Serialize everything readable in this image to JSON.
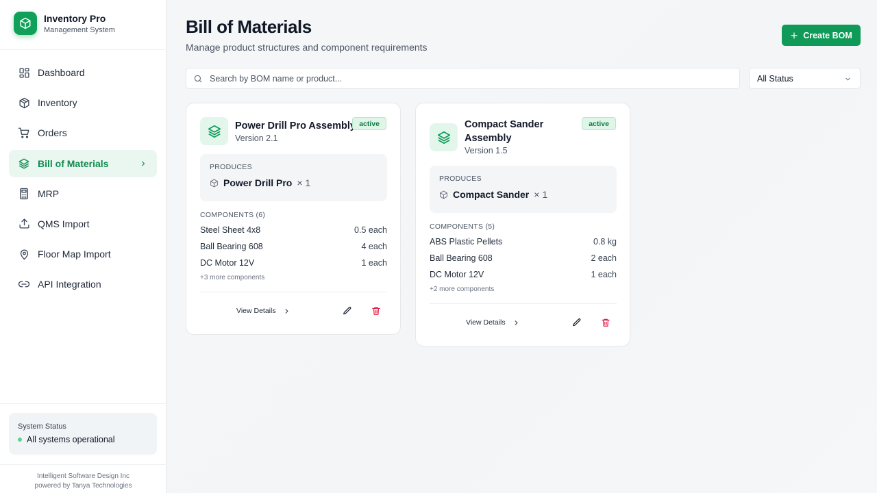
{
  "brand": {
    "title": "Inventory Pro",
    "subtitle": "Management System"
  },
  "nav": [
    {
      "label": "Dashboard",
      "icon": "dashboard-icon"
    },
    {
      "label": "Inventory",
      "icon": "box-icon"
    },
    {
      "label": "Orders",
      "icon": "cart-icon"
    },
    {
      "label": "Bill of Materials",
      "icon": "layers-icon",
      "active": true
    },
    {
      "label": "MRP",
      "icon": "calculator-icon"
    },
    {
      "label": "QMS Import",
      "icon": "upload-icon"
    },
    {
      "label": "Floor Map Import",
      "icon": "map-pin-icon"
    },
    {
      "label": "API Integration",
      "icon": "link-icon"
    }
  ],
  "system_status": {
    "label": "System Status",
    "text": "All systems operational"
  },
  "footer": {
    "line1": "Intelligent Software Design Inc",
    "line2": "powered by Tanya Technologies"
  },
  "header": {
    "title": "Bill of Materials",
    "subtitle": "Manage product structures and component requirements",
    "create_label": "Create BOM"
  },
  "search": {
    "placeholder": "Search by BOM name or product..."
  },
  "status_filter": {
    "selected": "All Status"
  },
  "cards": [
    {
      "title": "Power Drill Pro Assembly",
      "version": "Version 2.1",
      "status": "active",
      "produces_label": "PRODUCES",
      "product": "Power Drill Pro",
      "product_qty": "× 1",
      "components_label": "COMPONENTS (6)",
      "components": [
        {
          "name": "Steel Sheet 4x8",
          "qty": "0.5 each"
        },
        {
          "name": "Ball Bearing 608",
          "qty": "4 each"
        },
        {
          "name": "DC Motor 12V",
          "qty": "1 each"
        }
      ],
      "more": "+3 more components",
      "view_label": "View Details"
    },
    {
      "title": "Compact Sander Assembly",
      "version": "Version 1.5",
      "status": "active",
      "produces_label": "PRODUCES",
      "product": "Compact Sander",
      "product_qty": "× 1",
      "components_label": "COMPONENTS (5)",
      "components": [
        {
          "name": "ABS Plastic Pellets",
          "qty": "0.8 kg"
        },
        {
          "name": "Ball Bearing 608",
          "qty": "2 each"
        },
        {
          "name": "DC Motor 12V",
          "qty": "1 each"
        }
      ],
      "more": "+2 more components",
      "view_label": "View Details"
    }
  ],
  "colors": {
    "accent": "#0f9a58",
    "active_bg": "#eaf7f0",
    "danger": "#e11d48"
  }
}
